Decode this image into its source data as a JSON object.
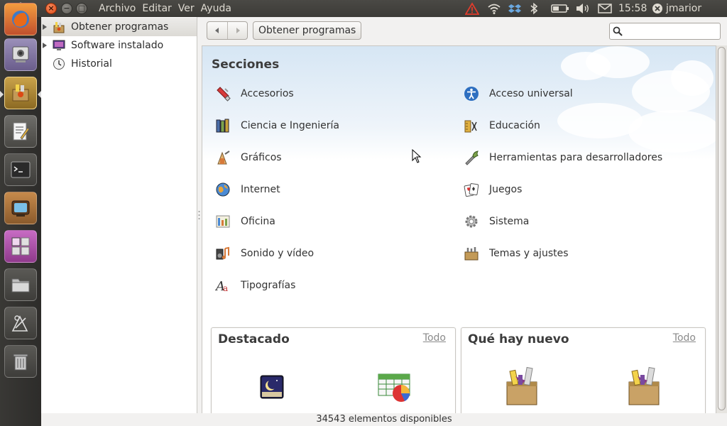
{
  "panel": {
    "menus": [
      "Archivo",
      "Editar",
      "Ver",
      "Ayuda"
    ],
    "clock": "15:58",
    "user": "jmarior"
  },
  "sidebar": {
    "items": [
      {
        "label": "Obtener programas"
      },
      {
        "label": "Software instalado"
      },
      {
        "label": "Historial"
      }
    ]
  },
  "toolbar": {
    "breadcrumb": "Obtener programas",
    "search_placeholder": ""
  },
  "main": {
    "sections_title": "Secciones",
    "categories_left": [
      "Accesorios",
      "Ciencia e Ingeniería",
      "Gráficos",
      "Internet",
      "Oficina",
      "Sonido y vídeo",
      "Tipografías"
    ],
    "categories_right": [
      "Acceso universal",
      "Educación",
      "Herramientas para desarrolladores",
      "Juegos",
      "Sistema",
      "Temas y ajustes"
    ],
    "featured": {
      "title": "Destacado",
      "link": "Todo"
    },
    "whats_new": {
      "title": "Qué hay nuevo",
      "link": "Todo"
    }
  },
  "status": {
    "text": "34543 elementos disponibles"
  },
  "colors": {
    "accent": "#df4a16",
    "panel_bg": "#3c3b37",
    "launcher_bg": "#2d2c2a",
    "sky": "#d6e6f4"
  }
}
